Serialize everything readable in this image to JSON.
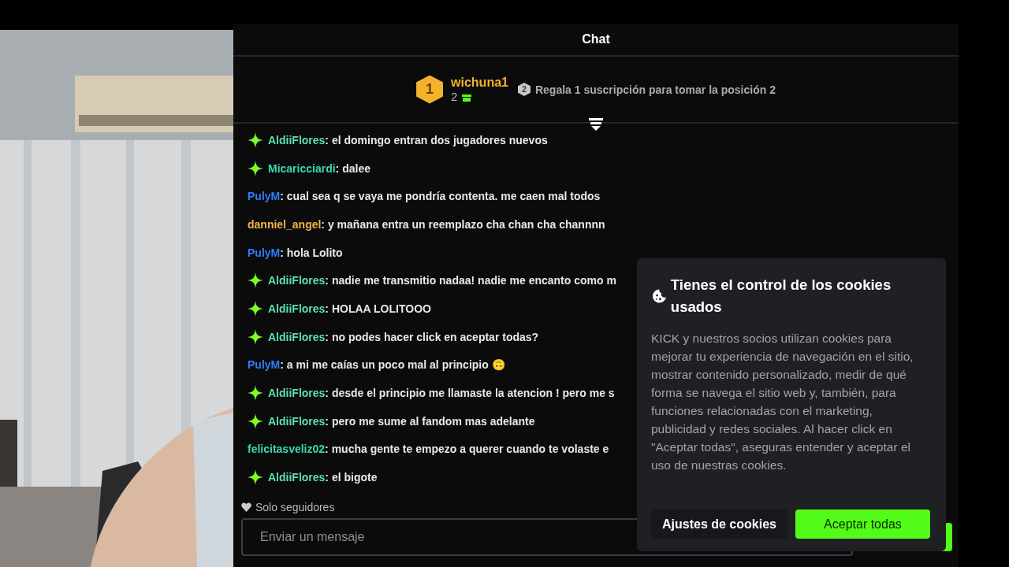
{
  "chat": {
    "title": "Chat",
    "leader": {
      "rank": "1",
      "name": "wichuna1",
      "count": "2",
      "next_rank": "2",
      "hint": "Regala 1 suscripción para tomar la posición 2"
    },
    "messages": [
      {
        "user": "AldiiFlores",
        "color": "#5ee0b0",
        "badge": true,
        "sep": ":",
        "text": "el domingo entran dos jugadores nuevos"
      },
      {
        "user": "Micaricciardi",
        "color": "#3ad8b0",
        "badge": true,
        "sep": ":",
        "text": "dalee"
      },
      {
        "user": "PulyM",
        "color": "#2f7df6",
        "badge": false,
        "sep": ":",
        "text": "cual sea q se vaya me pondría contenta. me caen mal todos"
      },
      {
        "user": "danniel_angel",
        "color": "#f0b34a",
        "badge": false,
        "sep": ":",
        "text": "y mañana entra un reemplazo cha chan cha channnn"
      },
      {
        "user": "PulyM",
        "color": "#2f7df6",
        "badge": false,
        "sep": ":",
        "text": "hola Lolito"
      },
      {
        "user": "AldiiFlores",
        "color": "#5ee0b0",
        "badge": true,
        "sep": ":",
        "text": "nadie me transmitio nadaa! nadie me encanto como m"
      },
      {
        "user": "AldiiFlores",
        "color": "#5ee0b0",
        "badge": true,
        "sep": ":",
        "text": "HOLAA LOLITOOO"
      },
      {
        "user": "AldiiFlores",
        "color": "#5ee0b0",
        "badge": true,
        "sep": ":",
        "text": "no podes hacer click en aceptar todas?"
      },
      {
        "user": "PulyM",
        "color": "#2f7df6",
        "badge": false,
        "sep": ":",
        "text": "a mi me caías un poco mal al principio 🙃"
      },
      {
        "user": "AldiiFlores",
        "color": "#5ee0b0",
        "badge": true,
        "sep": ":",
        "text": "desde el principio me llamaste la atencion ! pero me s"
      },
      {
        "user": "AldiiFlores",
        "color": "#5ee0b0",
        "badge": true,
        "sep": ":",
        "text": "pero me sume al fandom mas adelante"
      },
      {
        "user": "felicitasveliz02",
        "color": "#3ad8b0",
        "badge": false,
        "sep": ":",
        "text": "mucha gente te empezo a querer cuando te volaste e"
      },
      {
        "user": "AldiiFlores",
        "color": "#5ee0b0",
        "badge": true,
        "sep": ":",
        "text": "el bigote"
      }
    ],
    "mode": "Solo seguidores",
    "input": {
      "placeholder": "Enviar un mensaje"
    }
  },
  "cookies": {
    "title": "Tienes el control de los cookies usados",
    "body": "KICK y nuestros socios utilizan cookies para mejorar tu experiencia de navegación en el sitio, mostrar contenido personalizado, medir de qué forma se navega el sitio web y, también, para funciones relacionadas con el marketing, publicidad y redes sociales. Al hacer click en \"Aceptar todas\", aseguras entender y aceptar el uso de nuestras cookies.",
    "buttons": [
      {
        "label": "Ajustes de cookies",
        "kind": "secondary"
      },
      {
        "label": "Aceptar todas",
        "kind": "primary"
      }
    ]
  }
}
